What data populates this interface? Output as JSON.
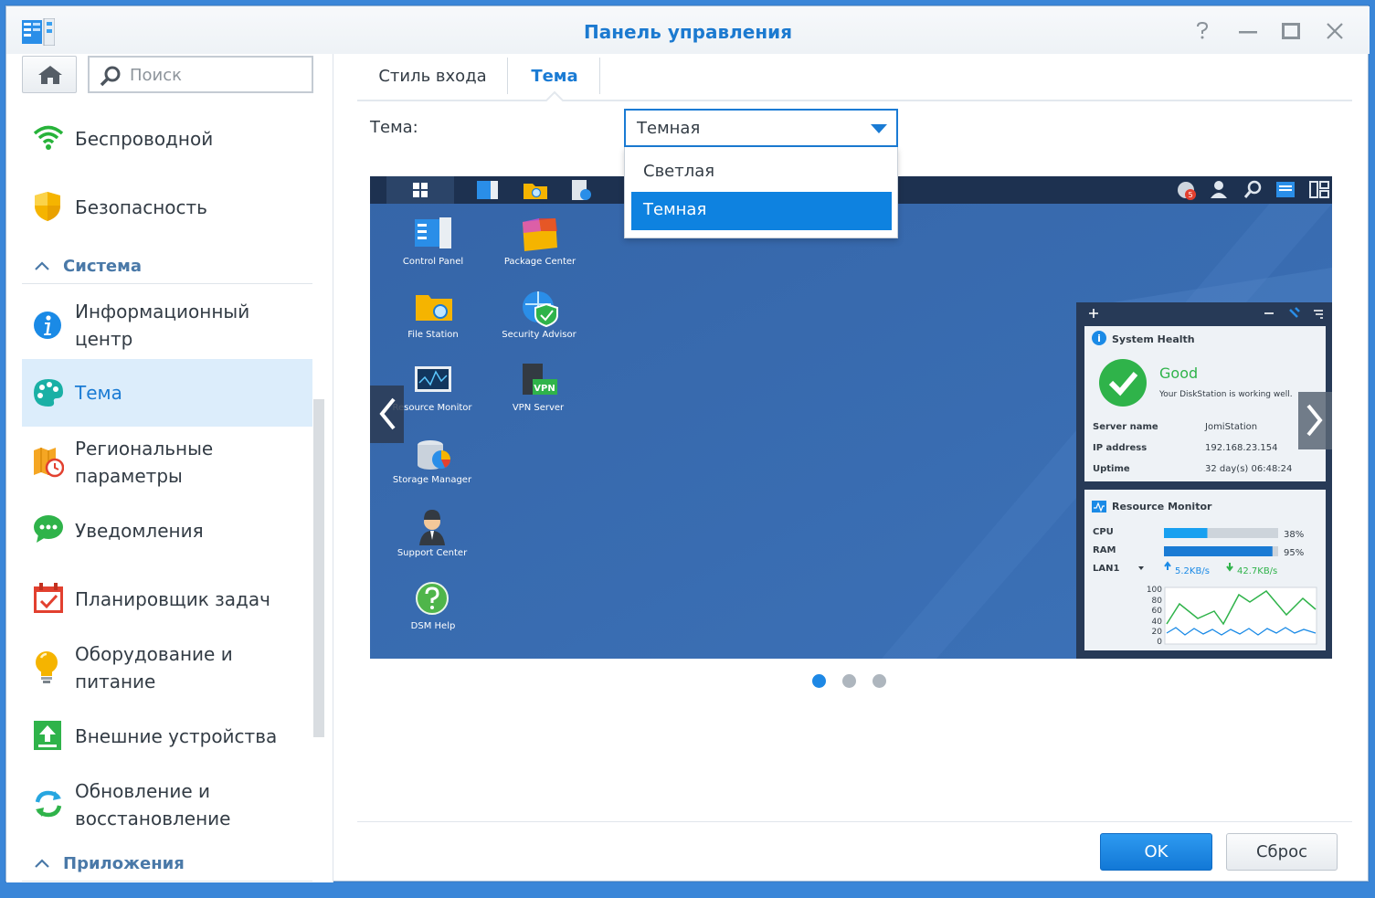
{
  "window": {
    "title": "Панель управления"
  },
  "sidebar": {
    "search_placeholder": "Поиск",
    "items": [
      {
        "label": "Беспроводной"
      },
      {
        "label": "Безопасность"
      },
      {
        "label": "Система",
        "section": true
      },
      {
        "label": "Информационный центр"
      },
      {
        "label": "Тема",
        "active": true
      },
      {
        "label": "Региональные параметры"
      },
      {
        "label": "Уведомления"
      },
      {
        "label": "Планировщик задач"
      },
      {
        "label": "Оборудование и питание"
      },
      {
        "label": "Внешние устройства"
      },
      {
        "label": "Обновление и восстановление"
      },
      {
        "label": "Приложения",
        "section": true
      }
    ],
    "lines": {
      "info": [
        "Информационный",
        "центр"
      ],
      "regional": [
        "Региональные",
        "параметры"
      ],
      "hardware": [
        "Оборудование и",
        "питание"
      ],
      "update": [
        "Обновление и",
        "восстановление"
      ]
    }
  },
  "tabs": [
    {
      "label": "Стиль входа"
    },
    {
      "label": "Тема",
      "active": true
    }
  ],
  "theme_field": {
    "label": "Тема:",
    "value": "Темная",
    "options": [
      "Светлая",
      "Темная"
    ]
  },
  "preview": {
    "desktop_icons": [
      "Control Panel",
      "Package Center",
      "File Station",
      "Security Advisor",
      "Resource Monitor",
      "VPN Server",
      "Storage Manager",
      "Support Center",
      "DSM Help"
    ],
    "vpn_badge": "VPN",
    "notification_count": "5",
    "system_health": {
      "title": "System Health",
      "status": "Good",
      "message": "Your DiskStation is working well.",
      "rows": [
        {
          "key": "Server name",
          "value": "JomiStation"
        },
        {
          "key": "IP address",
          "value": "192.168.23.154"
        },
        {
          "key": "Uptime",
          "value": "32 day(s) 06:48:24"
        }
      ]
    },
    "resource_monitor": {
      "title": "Resource Monitor",
      "cpu_label": "CPU",
      "cpu_value": "38%",
      "cpu": 0.38,
      "ram_label": "RAM",
      "ram_value": "95%",
      "ram": 0.95,
      "lan_label": "LAN1",
      "upload": "5.2KB/s",
      "download": "42.7KB/s",
      "yticks": [
        "100",
        "80",
        "60",
        "40",
        "20",
        "0"
      ]
    }
  },
  "pagination": {
    "count": 3,
    "current": 1
  },
  "buttons": {
    "ok": "OK",
    "reset": "Сброс"
  },
  "colors": {
    "accent": "#1a7bd4",
    "desktop": "#3a6baa",
    "selected": "#0e82e0"
  }
}
